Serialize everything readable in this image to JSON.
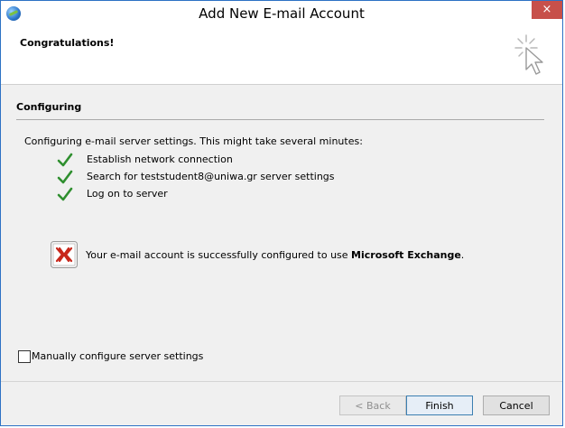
{
  "window": {
    "title": "Add New E-mail Account",
    "close_label": "×"
  },
  "header": {
    "title": "Congratulations!"
  },
  "main": {
    "section_title": "Configuring",
    "description": "Configuring e-mail server settings. This might take several minutes:",
    "steps": [
      {
        "label": "Establish network connection",
        "status": "done"
      },
      {
        "label": "Search for teststudent8@uniwa.gr server settings",
        "status": "done"
      },
      {
        "label": "Log on to server",
        "status": "done"
      }
    ],
    "success_prefix": "Your e-mail account is successfully configured to use ",
    "success_product": "Microsoft Exchange",
    "success_suffix": "."
  },
  "options": {
    "manual_config_label": "Manually configure server settings",
    "manual_config_checked": false
  },
  "buttons": {
    "back": "< Back",
    "finish": "Finish",
    "cancel": "Cancel"
  },
  "colors": {
    "accent": "#2d72c4",
    "check_green": "#2f8f2f",
    "close_red": "#c7504a",
    "exchange_red": "#c8261a"
  }
}
